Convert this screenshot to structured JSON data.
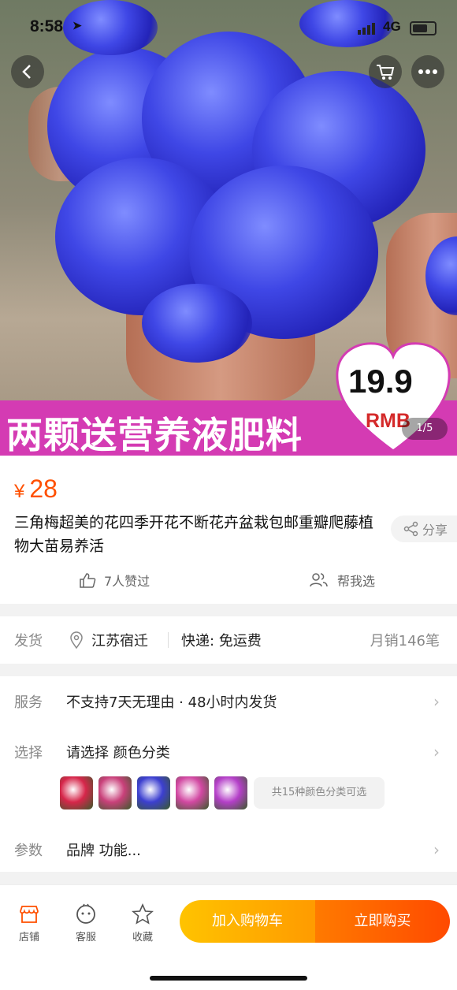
{
  "status_bar": {
    "time": "8:58",
    "network": "4G"
  },
  "hero": {
    "banner_text": "两颗送营养液肥料",
    "promo_price": "19.9",
    "promo_unit": "RMB",
    "pager": "1/5"
  },
  "product": {
    "price_symbol": "¥",
    "price": "28",
    "title": "三角梅超美的花四季开花不断花卉盆栽包邮重瓣爬藤植物大苗易养活",
    "share_label": "分享",
    "likes_label": "7人赞过",
    "help_choose_label": "帮我选"
  },
  "shipping": {
    "label": "发货",
    "location": "江苏宿迁",
    "express": "快递: 免运费",
    "monthly_sales": "月销146笔"
  },
  "service": {
    "label": "服务",
    "value": "不支持7天无理由 · 48小时内发货"
  },
  "select": {
    "label": "选择",
    "value": "请选择 颜色分类",
    "more_colors": "共15种颜色分类可选",
    "thumb_colors": [
      "#d6264a",
      "#c9407a",
      "#3c3fd0",
      "#d248a2",
      "#b43fc8"
    ]
  },
  "params": {
    "label": "参数",
    "value": "品牌 功能..."
  },
  "bottom_bar": {
    "store_label": "店铺",
    "service_label": "客服",
    "favorite_label": "收藏",
    "add_to_cart": "加入购物车",
    "buy_now": "立即购买"
  }
}
